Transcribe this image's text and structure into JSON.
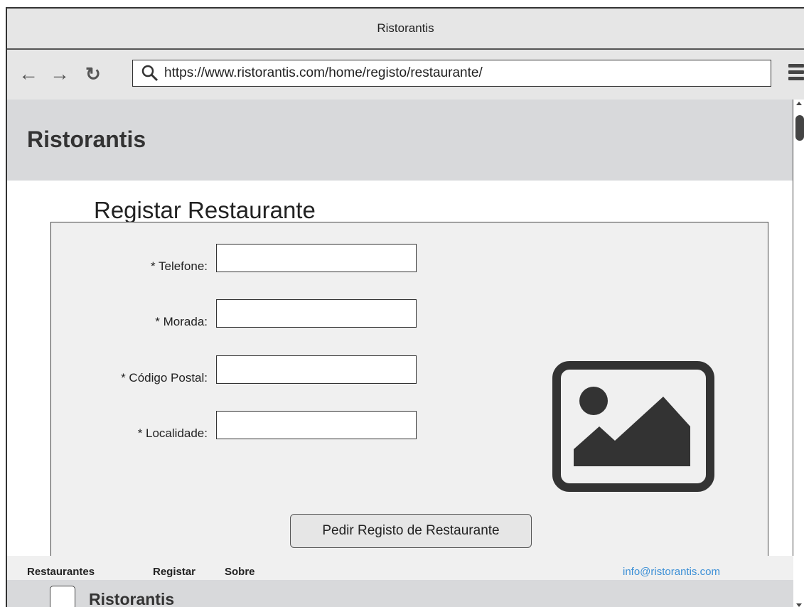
{
  "window": {
    "title": "Ristorantis"
  },
  "browser": {
    "back_icon": "arrow-left-icon",
    "forward_icon": "arrow-right-icon",
    "reload_icon": "reload-icon",
    "search_icon": "search-icon",
    "url": "https://www.ristorantis.com/home/registo/restaurante/",
    "menu_icon": "hamburger-menu-icon"
  },
  "header": {
    "site_title": "Ristorantis"
  },
  "page": {
    "title": "Registar Restaurante"
  },
  "form": {
    "fields": [
      {
        "label": "* Telefone:",
        "value": ""
      },
      {
        "label": "* Morada:",
        "value": ""
      },
      {
        "label": "* Código Postal:",
        "value": ""
      },
      {
        "label": "* Localidade:",
        "value": ""
      }
    ],
    "image_icon": "image-placeholder-icon",
    "submit_label": "Pedir Registo de Restaurante"
  },
  "footer": {
    "links": [
      "Restaurantes",
      "Registar",
      "Sobre"
    ],
    "email": "info@ristorantis.com",
    "brand": "Ristorantis"
  },
  "colors": {
    "link": "#3b8fd6",
    "header_bg": "#d8d9db",
    "panel_bg": "#f0f0f0"
  }
}
